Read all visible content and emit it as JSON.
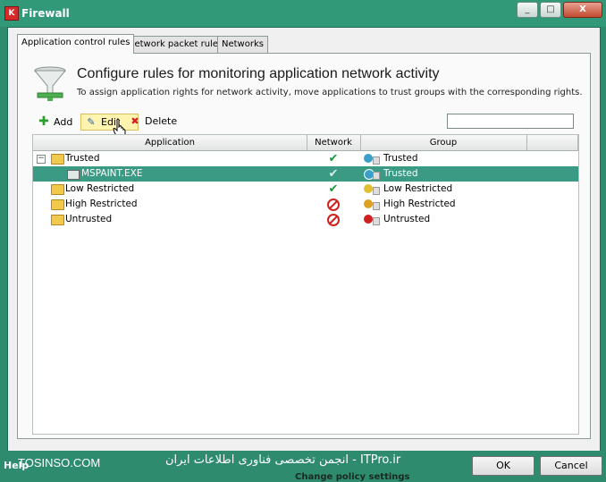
{
  "window": {
    "title": "Firewall",
    "min_glyph": "_",
    "max_glyph": "□",
    "close_glyph": "X"
  },
  "tabs": [
    {
      "label": "Application control rules",
      "active": true
    },
    {
      "label": "Network packet rules",
      "active": false
    },
    {
      "label": "Networks",
      "active": false
    }
  ],
  "header": {
    "title": "Configure rules for monitoring application network activity",
    "subtitle": "To assign application rights for network activity, move applications to trust groups with the corresponding rights."
  },
  "toolbar": {
    "add_label": "Add",
    "edit_label": "Edit",
    "delete_label": "Delete",
    "search_value": ""
  },
  "table": {
    "columns": [
      "Application",
      "Network",
      "Group"
    ],
    "rows": [
      {
        "app": "Trusted",
        "type": "group",
        "expanded": true,
        "network": "allow",
        "group": "Trusted",
        "group_color": "#3aa0c8"
      },
      {
        "app": "MSPAINT.EXE",
        "type": "app",
        "selected": true,
        "network": "allow",
        "group": "Trusted",
        "group_color": "#3aa0c8"
      },
      {
        "app": "Low Restricted",
        "type": "group",
        "network": "allow",
        "group": "Low Restricted",
        "group_color": "#e0c030"
      },
      {
        "app": "High Restricted",
        "type": "group",
        "network": "deny",
        "group": "High Restricted",
        "group_color": "#e0a020"
      },
      {
        "app": "Untrusted",
        "type": "group",
        "network": "deny",
        "group": "Untrusted",
        "group_color": "#d02020"
      }
    ]
  },
  "footer": {
    "help_label": "Help",
    "watermark_left": "TOSINSO.COM",
    "watermark_right": "ITPro.ir - انجمن تخصصی فناوری اطلاعات ایران",
    "ok_label": "OK",
    "cancel_label": "Cancel",
    "peek_text": "Change policy settings"
  }
}
